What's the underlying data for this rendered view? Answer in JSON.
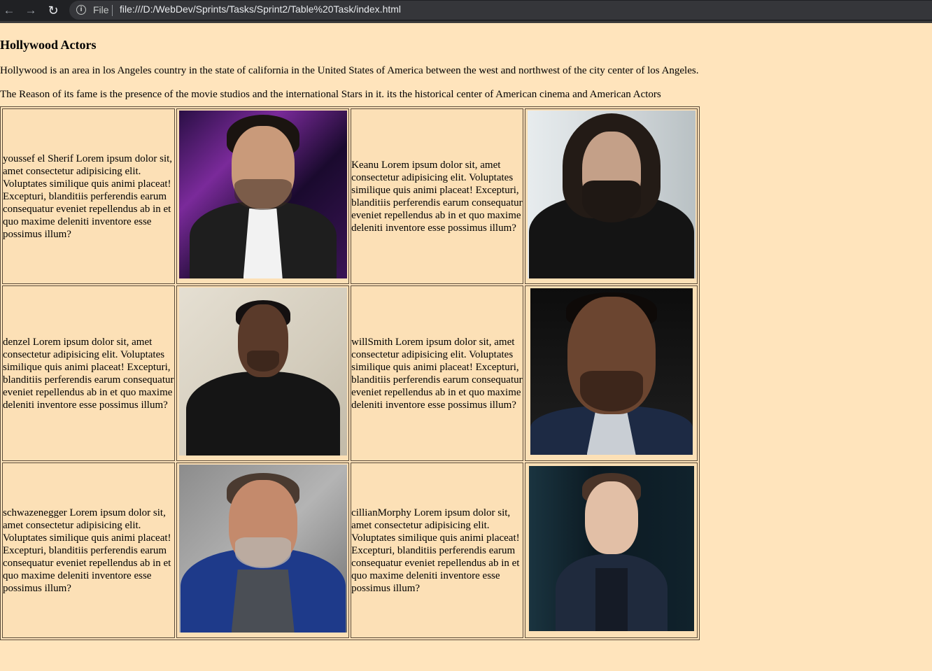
{
  "browser": {
    "file_label": "File",
    "url": "file:///D:/WebDev/Sprints/Tasks/Sprint2/Table%20Task/index.html",
    "icons": [
      "back-arrow-icon",
      "forward-arrow-icon",
      "reload-icon",
      "info-icon"
    ]
  },
  "page": {
    "title": "Hollywood Actors",
    "paragraph1": "Hollywood is an area in los Angeles country in the state of california in the United States of America between the west and northwest of the city center of los Angeles.",
    "paragraph2": "The Reason of its fame is the presence of the movie studios and the international Stars in it. its the historical center of American cinema and American Actors"
  },
  "table": {
    "rows": [
      {
        "left_text": "youssef el Sherif Lorem ipsum dolor sit, amet consectetur adipisicing elit. Voluptates similique quis animi placeat! Excepturi, blanditiis perferendis earum consequatur eveniet repellendus ab in et quo maxime deleniti inventore esse possimus illum?",
        "left_photo": "youssef-el-sherif-photo",
        "right_text": "Keanu Lorem ipsum dolor sit, amet consectetur adipisicing elit. Voluptates similique quis animi placeat! Excepturi, blanditiis perferendis earum consequatur eveniet repellendus ab in et quo maxime deleniti inventore esse possimus illum?",
        "right_photo": "keanu-photo"
      },
      {
        "left_text": "denzel Lorem ipsum dolor sit, amet consectetur adipisicing elit. Voluptates similique quis animi placeat! Excepturi, blanditiis perferendis earum consequatur eveniet repellendus ab in et quo maxime deleniti inventore esse possimus illum?",
        "left_photo": "denzel-photo",
        "right_text": "willSmith Lorem ipsum dolor sit, amet consectetur adipisicing elit. Voluptates similique quis animi placeat! Excepturi, blanditiis perferendis earum consequatur eveniet repellendus ab in et quo maxime deleniti inventore esse possimus illum?",
        "right_photo": "will-smith-photo"
      },
      {
        "left_text": "schwazenegger Lorem ipsum dolor sit, amet consectetur adipisicing elit. Voluptates similique quis animi placeat! Excepturi, blanditiis perferendis earum consequatur eveniet repellendus ab in et quo maxime deleniti inventore esse possimus illum?",
        "left_photo": "schwarzenegger-photo",
        "right_text": "cillianMorphy Lorem ipsum dolor sit, amet consectetur adipisicing elit. Voluptates similique quis animi placeat! Excepturi, blanditiis perferendis earum consequatur eveniet repellendus ab in et quo maxime deleniti inventore esse possimus illum?",
        "right_photo": "cillian-murphy-photo"
      }
    ]
  },
  "colors": {
    "page_background": "#ffe4bc",
    "cell_background": "#fce0b6",
    "border": "#5a4a38",
    "chrome_bar": "#202124"
  }
}
